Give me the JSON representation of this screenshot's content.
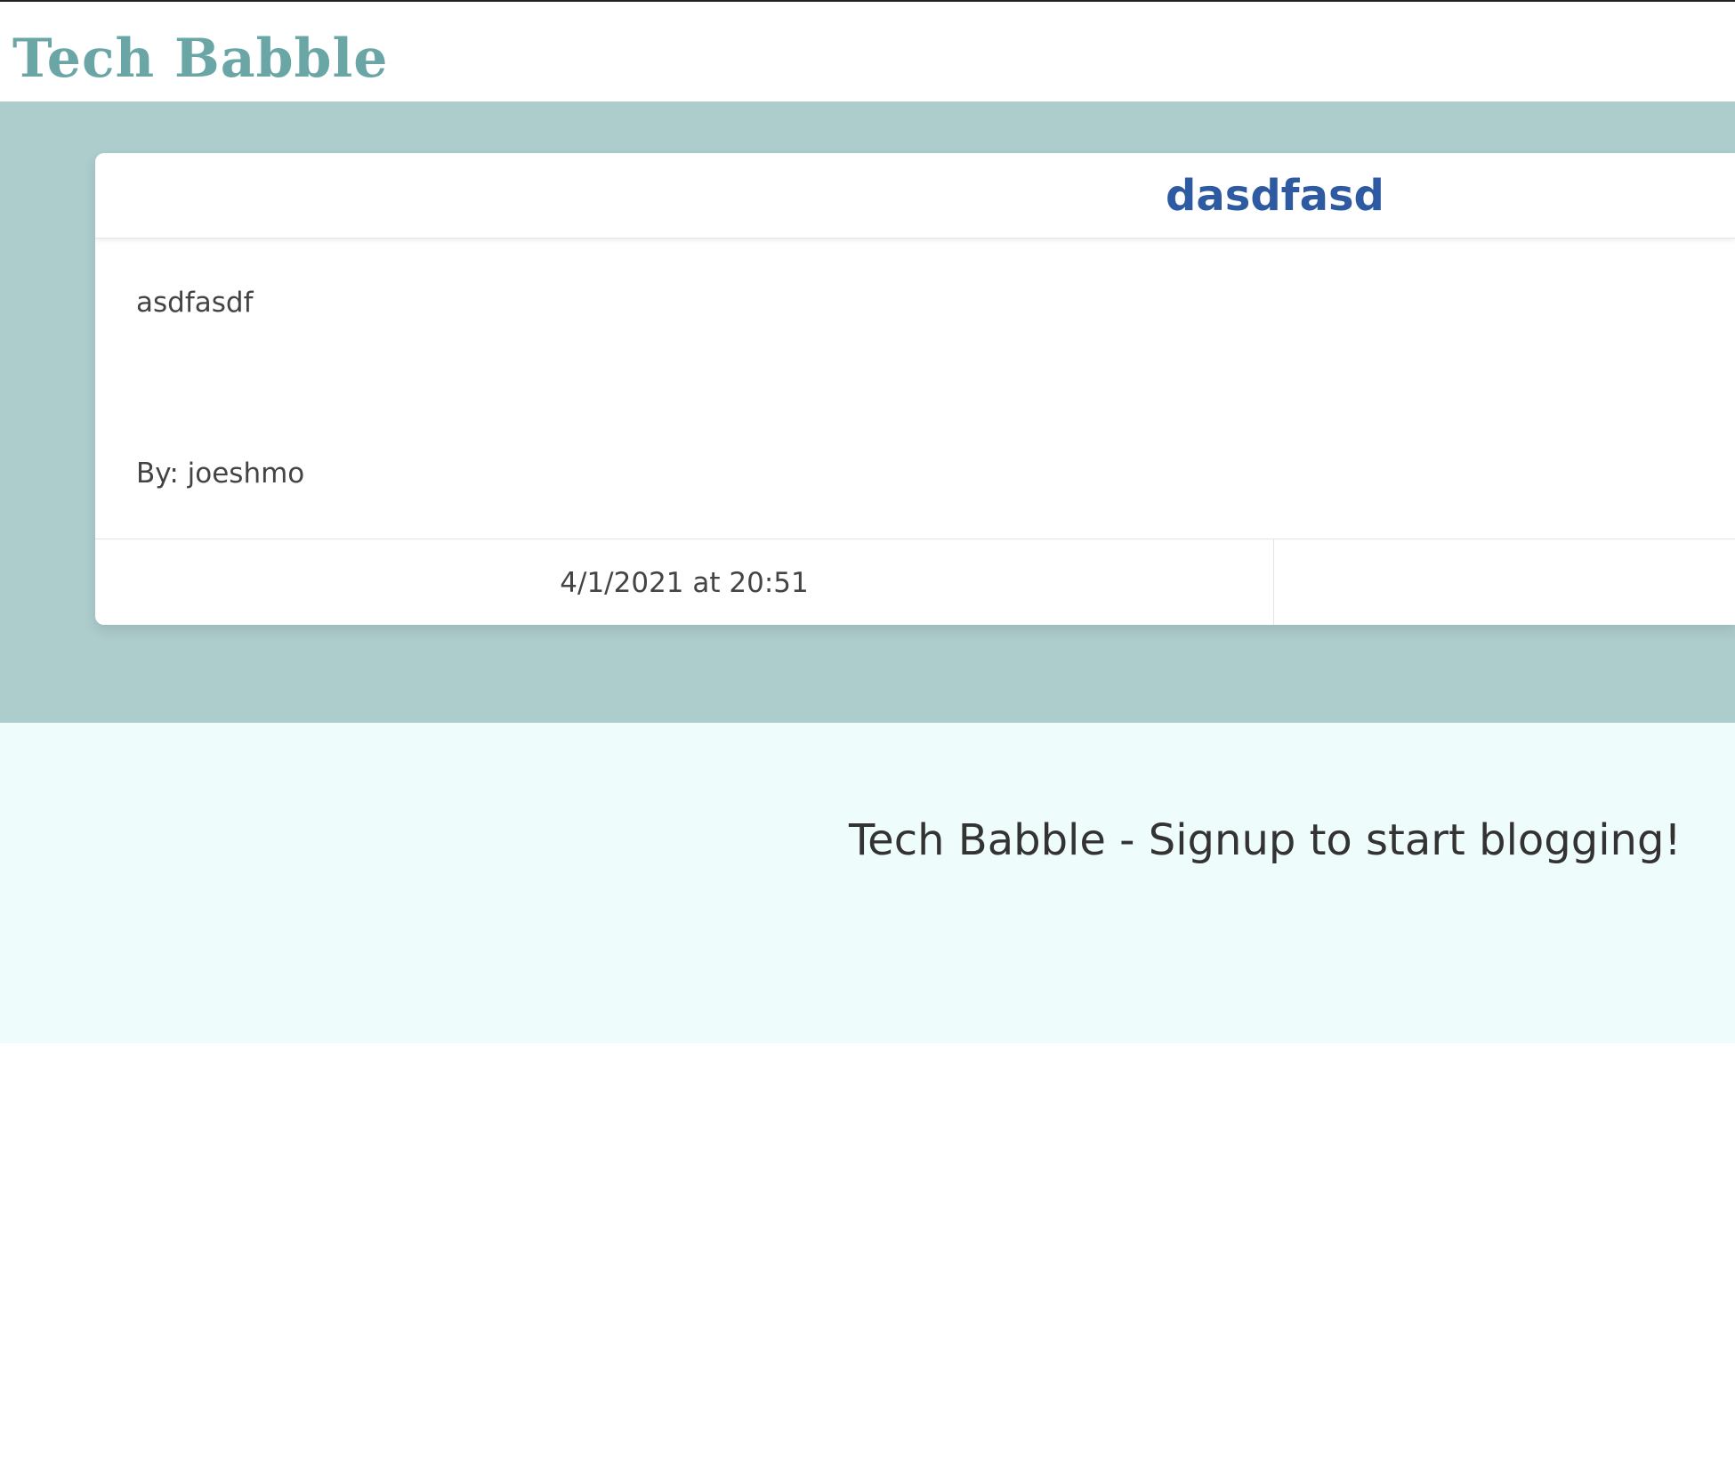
{
  "header": {
    "site_title": "Tech Babble"
  },
  "post": {
    "title": "dasdfasd",
    "body": "asdfasdf",
    "author": "By: joeshmo",
    "timestamp": "4/1/2021 at 20:51"
  },
  "footer": {
    "text": "Tech Babble - Signup to start blogging!"
  },
  "colors": {
    "title_teal": "#6aa6a6",
    "band_teal": "#adcccc",
    "post_title_blue": "#2d5aa0",
    "footer_bg": "#effcfc"
  }
}
